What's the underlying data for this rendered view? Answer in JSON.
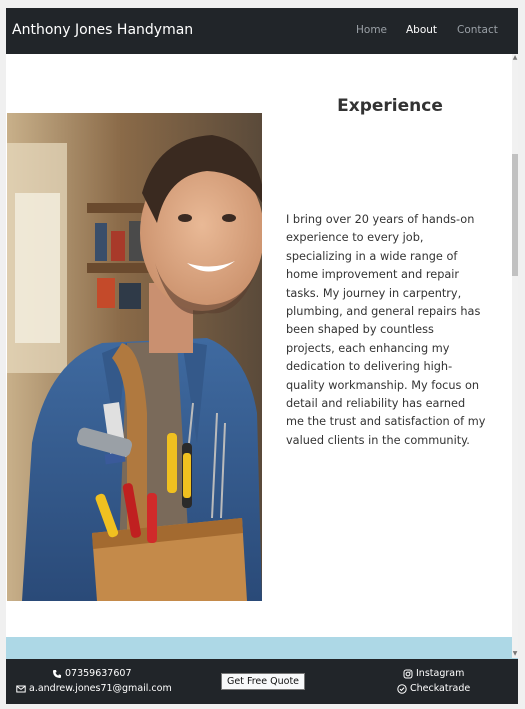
{
  "navbar": {
    "brand": "Anthony Jones Handyman",
    "links": [
      {
        "label": "Home",
        "active": false
      },
      {
        "label": "About",
        "active": true
      },
      {
        "label": "Contact",
        "active": false
      }
    ]
  },
  "main": {
    "heading": "Experience",
    "bio": "I bring over 20 years of hands-on experience to every job, specializing in a wide range of home improvement and repair tasks. My journey in carpentry, plumbing, and general repairs has been shaped by countless projects, each enhancing my dedication to delivering high-quality workmanship. My focus on detail and reliability has earned me the trust and satisfaction of my valued clients in the community."
  },
  "footer": {
    "phone": "07359637607",
    "email": "a.andrew.jones71@gmail.com",
    "quote_button": "Get Free Quote",
    "instagram": "Instagram",
    "checkatrade": "Checkatrade"
  },
  "colors": {
    "navbar_bg": "#212529",
    "band_bg": "#add8e6"
  },
  "icons": [
    "phone-icon",
    "envelope-icon",
    "instagram-icon",
    "check-circle-icon"
  ]
}
